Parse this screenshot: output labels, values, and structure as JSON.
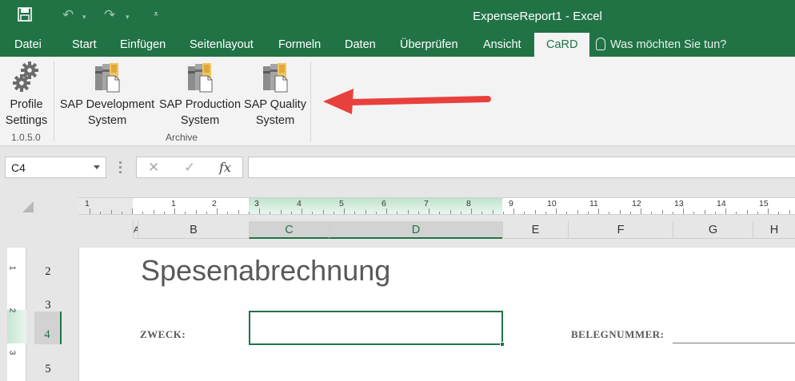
{
  "app": {
    "window_title": "ExpenseReport1 - Excel"
  },
  "quick_access": {
    "save_icon": "save-icon",
    "undo_icon": "undo-icon",
    "redo_icon": "redo-icon",
    "customize_icon": "customize-icon"
  },
  "tabs": [
    {
      "label": "Datei"
    },
    {
      "label": "Start"
    },
    {
      "label": "Einfügen"
    },
    {
      "label": "Seitenlayout"
    },
    {
      "label": "Formeln"
    },
    {
      "label": "Daten"
    },
    {
      "label": "Überprüfen"
    },
    {
      "label": "Ansicht"
    },
    {
      "label": "CaRD"
    }
  ],
  "tell_me": "Was möchten Sie tun?",
  "ribbon": {
    "profile": {
      "line1": "Profile",
      "line2": "Settings",
      "version": "1.0.5.0"
    },
    "archive_group": "Archive",
    "buttons": [
      {
        "line1": "SAP Development",
        "line2": "System"
      },
      {
        "line1": "SAP Production",
        "line2": "System"
      },
      {
        "line1": "SAP Quality",
        "line2": "System"
      }
    ]
  },
  "formula_bar": {
    "name_box": "C4",
    "cancel": "✕",
    "enter": "✓",
    "fx": "fx",
    "value": ""
  },
  "ruler_numbers": [
    "1",
    "1",
    "2",
    "3",
    "4",
    "5",
    "6",
    "7",
    "8",
    "9",
    "10",
    "11",
    "12",
    "13",
    "14",
    "15"
  ],
  "columns": [
    "A",
    "B",
    "C",
    "D",
    "E",
    "F",
    "G",
    "H"
  ],
  "rows": [
    "2",
    "3",
    "4",
    "5"
  ],
  "vertical_ruler": [
    "1",
    "2",
    "3"
  ],
  "sheet": {
    "title": "Spesenabrechnung",
    "purpose_label": "ZWECK:",
    "doc_number_label": "BELEGNUMMER:"
  }
}
